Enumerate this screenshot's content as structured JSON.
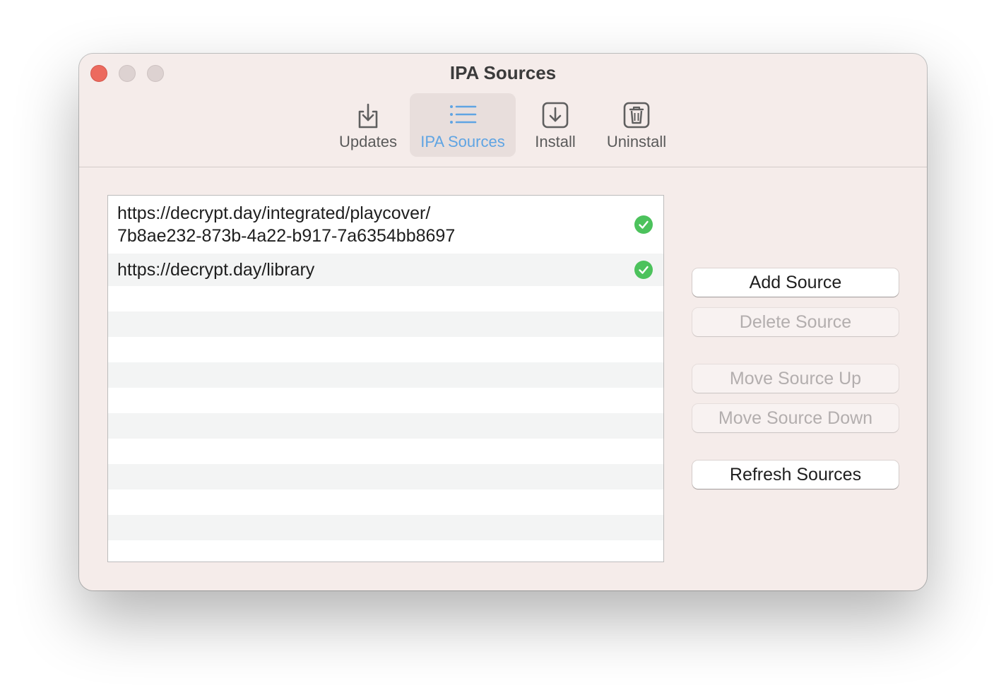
{
  "window": {
    "title": "IPA Sources"
  },
  "toolbar": {
    "tabs": [
      {
        "label": "Updates",
        "icon": "download-tray-icon",
        "selected": false
      },
      {
        "label": "IPA Sources",
        "icon": "list-icon",
        "selected": true
      },
      {
        "label": "Install",
        "icon": "install-arrow-icon",
        "selected": false
      },
      {
        "label": "Uninstall",
        "icon": "trash-icon",
        "selected": false
      }
    ]
  },
  "sources": {
    "items": [
      {
        "line1": "https://decrypt.day/integrated/playcover/",
        "line2": "7b8ae232-873b-4a22-b917-7a6354bb8697",
        "status": "valid",
        "status_icon": "green-checkmark-icon"
      },
      {
        "line1": "https://decrypt.day/library",
        "status": "valid",
        "status_icon": "green-checkmark-icon"
      }
    ]
  },
  "actions": {
    "add_source": {
      "label": "Add Source",
      "enabled": true
    },
    "delete_source": {
      "label": "Delete Source",
      "enabled": false
    },
    "move_up": {
      "label": "Move Source Up",
      "enabled": false
    },
    "move_down": {
      "label": "Move Source Down",
      "enabled": false
    },
    "refresh": {
      "label": "Refresh Sources",
      "enabled": true
    }
  },
  "colors": {
    "window_bg": "#f5ecea",
    "accent": "#5fa4e3",
    "close_button": "#ec6a5e",
    "valid_status": "#4cc25c"
  }
}
